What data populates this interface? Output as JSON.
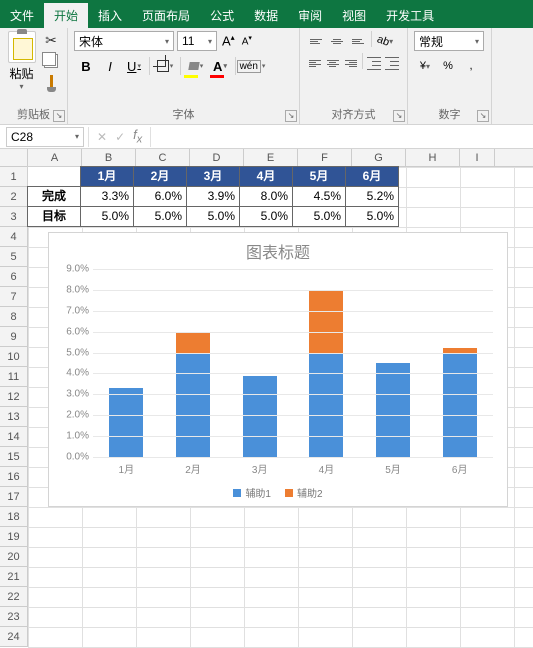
{
  "tabs": [
    "文件",
    "开始",
    "插入",
    "页面布局",
    "公式",
    "数据",
    "审阅",
    "视图",
    "开发工具"
  ],
  "active_tab_index": 1,
  "ribbon": {
    "clipboard": {
      "label": "剪贴板",
      "paste": "粘贴"
    },
    "font": {
      "label": "字体",
      "name": "宋体",
      "size": "11",
      "biu": [
        "B",
        "I",
        "U"
      ],
      "wen": "wén"
    },
    "align": {
      "label": "对齐方式",
      "ab": "ab"
    },
    "number": {
      "label": "数字",
      "format": "常规",
      "btns": [
        "¥",
        "%",
        ","
      ]
    }
  },
  "namebox": "C28",
  "columns": [
    "A",
    "B",
    "C",
    "D",
    "E",
    "F",
    "G",
    "H",
    "I"
  ],
  "row_numbers": [
    "1",
    "2",
    "3",
    "4",
    "5",
    "6",
    "7",
    "8",
    "9",
    "10",
    "11",
    "12",
    "13",
    "14",
    "15",
    "16",
    "17",
    "18",
    "19",
    "20",
    "21",
    "22",
    "23",
    "24"
  ],
  "table": {
    "months": [
      "1月",
      "2月",
      "3月",
      "4月",
      "5月",
      "6月"
    ],
    "rows": [
      {
        "label": "完成",
        "values": [
          "3.3%",
          "6.0%",
          "3.9%",
          "8.0%",
          "4.5%",
          "5.2%"
        ]
      },
      {
        "label": "目标",
        "values": [
          "5.0%",
          "5.0%",
          "5.0%",
          "5.0%",
          "5.0%",
          "5.0%"
        ]
      }
    ]
  },
  "chart_data": {
    "type": "bar",
    "title": "图表标题",
    "categories": [
      "1月",
      "2月",
      "3月",
      "4月",
      "5月",
      "6月"
    ],
    "series": [
      {
        "name": "辅助1",
        "values": [
          3.3,
          5.0,
          3.9,
          5.0,
          4.5,
          5.0
        ]
      },
      {
        "name": "辅助2",
        "values": [
          0.0,
          1.0,
          0.0,
          3.0,
          0.0,
          0.2
        ]
      }
    ],
    "ylim": [
      0,
      9
    ],
    "yticks": [
      "0.0%",
      "1.0%",
      "2.0%",
      "3.0%",
      "4.0%",
      "5.0%",
      "6.0%",
      "7.0%",
      "8.0%",
      "9.0%"
    ],
    "ylabel": "",
    "xlabel": ""
  }
}
